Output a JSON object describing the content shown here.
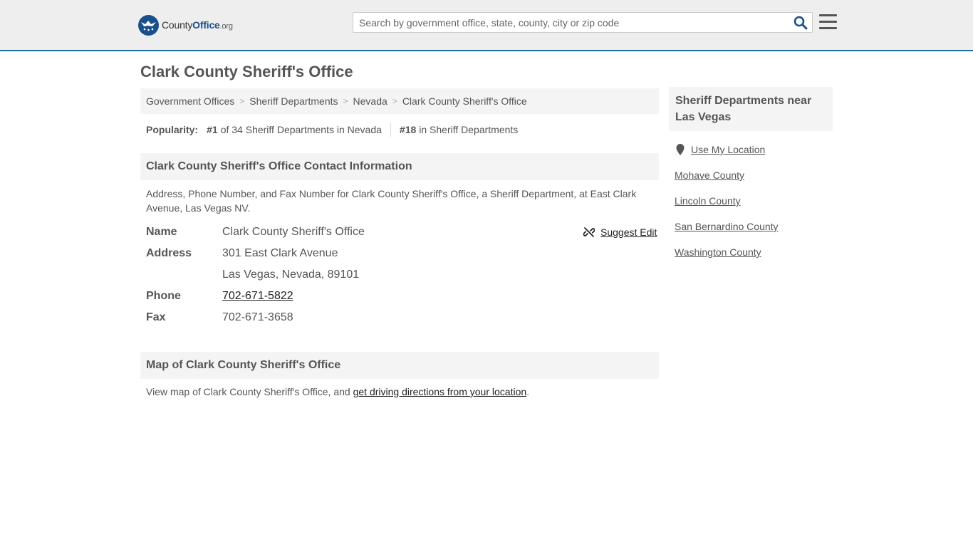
{
  "header": {
    "logo_brand_a": "County",
    "logo_brand_b": "Office",
    "logo_tld": ".org",
    "search_placeholder": "Search by government office, state, county, city or zip code"
  },
  "page": {
    "title": "Clark County Sheriff's Office"
  },
  "breadcrumb": [
    "Government Offices",
    "Sheriff Departments",
    "Nevada",
    "Clark County Sheriff's Office"
  ],
  "popularity": {
    "label": "Popularity:",
    "rank_state": "#1",
    "rank_state_text": "of 34 Sheriff Departments in Nevada",
    "rank_overall": "#18",
    "rank_overall_text": "in Sheriff Departments"
  },
  "contact": {
    "heading": "Clark County Sheriff's Office Contact Information",
    "description": "Address, Phone Number, and Fax Number for Clark County Sheriff's Office, a Sheriff Department, at East Clark Avenue, Las Vegas NV.",
    "suggest_edit": "Suggest Edit",
    "name_label": "Name",
    "name_value": "Clark County Sheriff's Office",
    "address_label": "Address",
    "address_line1": "301 East Clark Avenue",
    "address_line2": "Las Vegas, Nevada, 89101",
    "phone_label": "Phone",
    "phone_value": "702-671-5822",
    "fax_label": "Fax",
    "fax_value": "702-671-3658"
  },
  "map": {
    "heading": "Map of Clark County Sheriff's Office",
    "desc_prefix": "View map of Clark County Sheriff's Office, and ",
    "desc_link": "get driving directions from your location",
    "desc_suffix": "."
  },
  "sidebar": {
    "heading": "Sheriff Departments near Las Vegas",
    "use_location": "Use My Location",
    "links": [
      "Mohave County",
      "Lincoln County",
      "San Bernardino County",
      "Washington County"
    ]
  },
  "colors": {
    "brand_blue": "#1a4f8b",
    "accent_border": "#1a6cb0",
    "panel_bg": "#f4f4f4"
  },
  "icons": {
    "search": "search-icon",
    "menu": "hamburger-menu-icon",
    "edit": "unlink-icon",
    "location": "map-pin-icon"
  }
}
